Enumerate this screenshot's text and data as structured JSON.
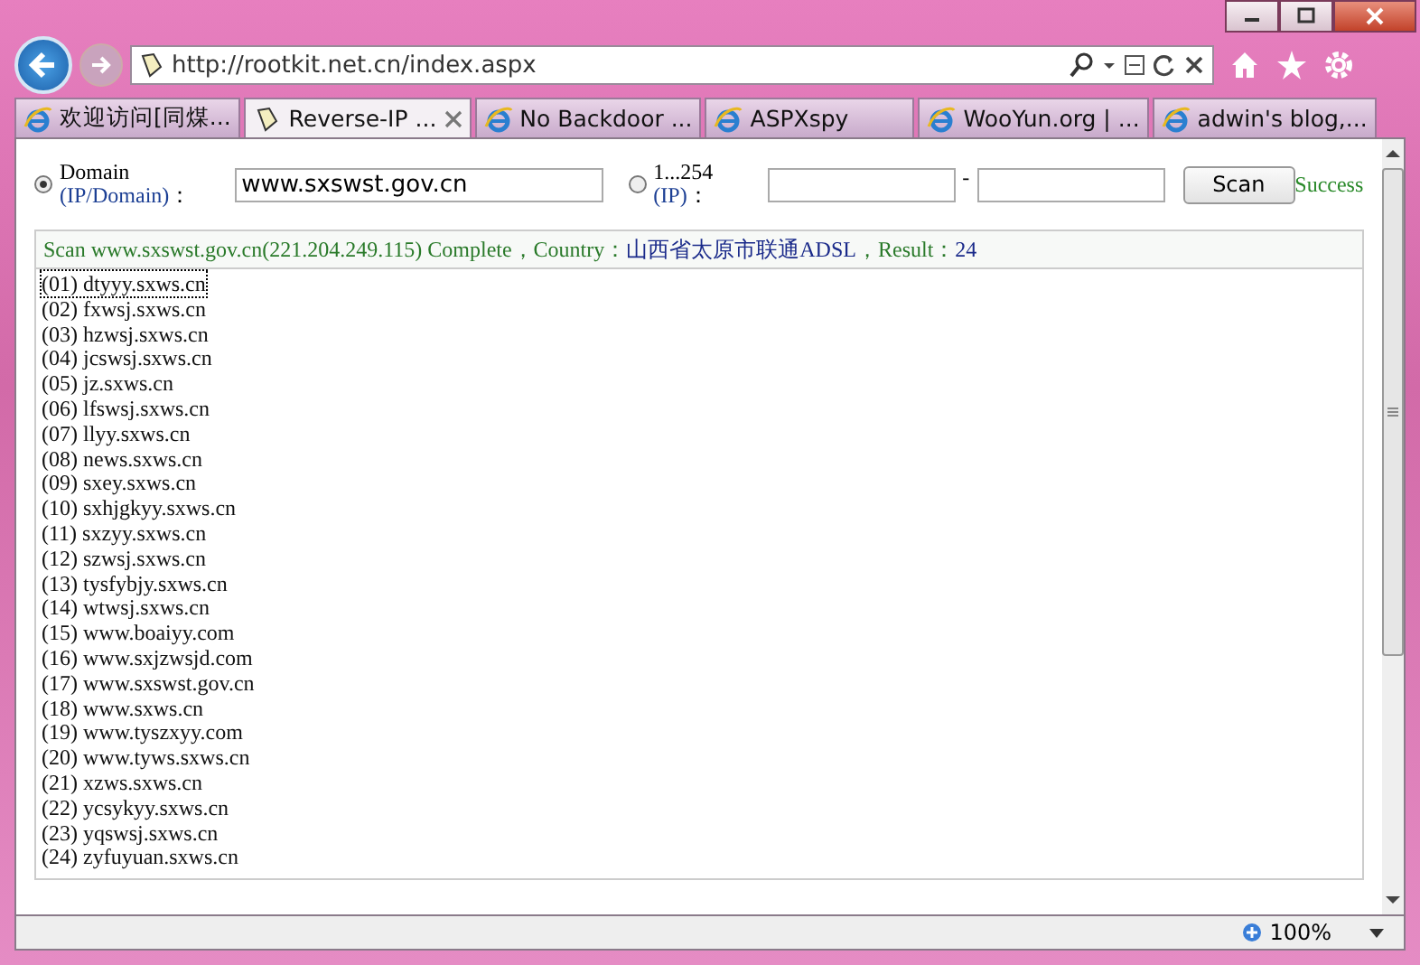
{
  "browser": {
    "address": "http://rootkit.net.cn/index.aspx",
    "tabs": [
      {
        "label": "欢迎访问[同煤...",
        "selected": false,
        "kind": "ie"
      },
      {
        "label": "Reverse-IP ...",
        "selected": true,
        "kind": "page"
      },
      {
        "label": "No Backdoor ...",
        "selected": false,
        "kind": "ie"
      },
      {
        "label": "ASPXspy",
        "selected": false,
        "kind": "ie"
      },
      {
        "label": "WooYun.org | ...",
        "selected": false,
        "kind": "ie"
      },
      {
        "label": "adwin's blog,...",
        "selected": false,
        "kind": "ie"
      }
    ],
    "zoom": "100%"
  },
  "form": {
    "domain_option": {
      "label": "Domain",
      "hint": "(IP/Domain)",
      "colon": "：",
      "selected": true
    },
    "domain_value": "www.sxswst.gov.cn",
    "ip_option": {
      "label": "1...254",
      "hint": "(IP)",
      "colon": "：",
      "selected": false
    },
    "ip_separator": "-",
    "scan_button": "Scan",
    "status": "Success"
  },
  "result": {
    "segments": [
      {
        "text": "Scan www.sxswst.gov.cn(221.204.249.115) Complete，Country：",
        "kind": "label"
      },
      {
        "text": "山西省太原市联通ADSL",
        "kind": "value"
      },
      {
        "text": "，Result：",
        "kind": "label"
      },
      {
        "text": "24",
        "kind": "value"
      }
    ],
    "rows": [
      {
        "text": "(01) dtyyy.sxws.cn",
        "focused": true
      },
      {
        "text": "(02) fxwsj.sxws.cn",
        "focused": false
      },
      {
        "text": "(03) hzwsj.sxws.cn",
        "focused": false
      },
      {
        "text": "(04) jcswsj.sxws.cn",
        "focused": false
      },
      {
        "text": "(05) jz.sxws.cn",
        "focused": false
      },
      {
        "text": "(06) lfswsj.sxws.cn",
        "focused": false
      },
      {
        "text": "(07) llyy.sxws.cn",
        "focused": false
      },
      {
        "text": "(08) news.sxws.cn",
        "focused": false
      },
      {
        "text": "(09) sxey.sxws.cn",
        "focused": false
      },
      {
        "text": "(10) sxhjgkyy.sxws.cn",
        "focused": false
      },
      {
        "text": "(11) sxzyy.sxws.cn",
        "focused": false
      },
      {
        "text": "(12) szwsj.sxws.cn",
        "focused": false
      },
      {
        "text": "(13) tysfybjy.sxws.cn",
        "focused": false
      },
      {
        "text": "(14) wtwsj.sxws.cn",
        "focused": false
      },
      {
        "text": "(15) www.boaiyy.com",
        "focused": false
      },
      {
        "text": "(16) www.sxjzwsjd.com",
        "focused": false
      },
      {
        "text": "(17) www.sxswst.gov.cn",
        "focused": false
      },
      {
        "text": "(18) www.sxws.cn",
        "focused": false
      },
      {
        "text": "(19) www.tyszxyy.com",
        "focused": false
      },
      {
        "text": "(20) www.tyws.sxws.cn",
        "focused": false
      },
      {
        "text": "(21) xzws.sxws.cn",
        "focused": false
      },
      {
        "text": "(22) ycsykyy.sxws.cn",
        "focused": false
      },
      {
        "text": "(23) yqswsj.sxws.cn",
        "focused": false
      },
      {
        "text": "(24) zyfuyuan.sxws.cn",
        "focused": false
      }
    ]
  }
}
